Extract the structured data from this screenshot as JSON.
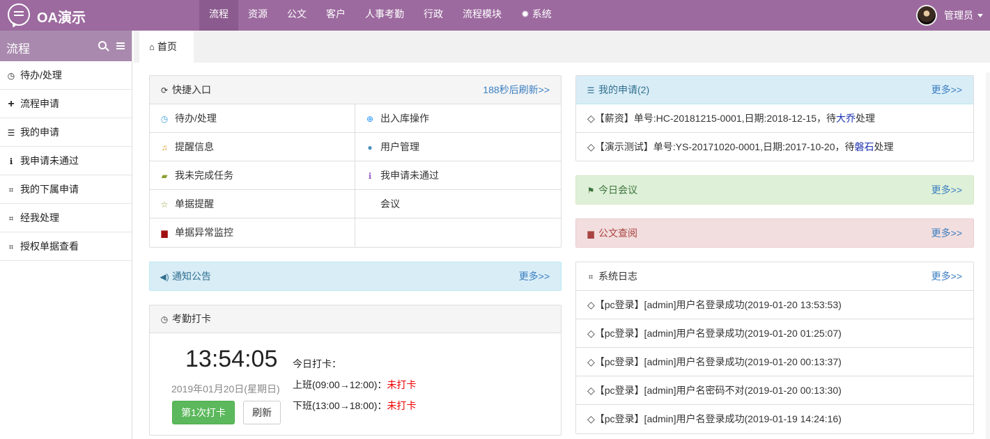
{
  "app": {
    "title": "OA演示"
  },
  "topnav": [
    {
      "label": "流程",
      "active": true
    },
    {
      "label": "资源"
    },
    {
      "label": "公文"
    },
    {
      "label": "客户"
    },
    {
      "label": "人事考勤"
    },
    {
      "label": "行政"
    },
    {
      "label": "流程模块"
    },
    {
      "label": "系统",
      "icon": "gear-icon"
    }
  ],
  "user": {
    "name": "管理员"
  },
  "sidebar": {
    "title": "流程",
    "items": [
      {
        "label": "待办/处理",
        "icon": "clock-icon"
      },
      {
        "label": "流程申请",
        "icon": "plus-icon"
      },
      {
        "label": "我的申请",
        "icon": "list-icon"
      },
      {
        "label": "我申请未通过",
        "icon": "info-icon"
      },
      {
        "label": "我的下属申请",
        "icon": "bookmark-icon"
      },
      {
        "label": "经我处理",
        "icon": "bookmark-icon"
      },
      {
        "label": "授权单据查看",
        "icon": "bookmark-icon"
      }
    ]
  },
  "tabs": [
    {
      "label": "首页",
      "icon": "home-icon"
    }
  ],
  "quick": {
    "title": "快捷入口",
    "refresh": "188秒后刷新>>",
    "items": [
      {
        "label": "待办/处理",
        "icon": "clock-icon",
        "color": "#3a9fd6"
      },
      {
        "label": "出入库操作",
        "icon": "plus-circle-icon",
        "color": "#1e90ff"
      },
      {
        "label": "提醒信息",
        "icon": "bell-icon",
        "color": "#e0a030"
      },
      {
        "label": "用户管理",
        "icon": "user-icon",
        "color": "#4a90c0"
      },
      {
        "label": "我未完成任务",
        "icon": "book-icon",
        "color": "#8aa030"
      },
      {
        "label": "我申请未通过",
        "icon": "info-icon",
        "color": "#9a60c0"
      },
      {
        "label": "单据提醒",
        "icon": "star-icon",
        "color": "#8aa030"
      },
      {
        "label": "会议",
        "icon": "",
        "color": ""
      },
      {
        "label": "单据异常监控",
        "icon": "briefcase-icon",
        "color": "#a01010"
      },
      {
        "label": "",
        "icon": "",
        "color": ""
      }
    ]
  },
  "notice": {
    "title": "通知公告",
    "more": "更多>>"
  },
  "attendance": {
    "title": "考勤打卡",
    "time": "13:54:05",
    "date": "2019年01月20日(星期日)",
    "punch_button": "第1次打卡",
    "refresh_button": "刷新",
    "today_label": "今日打卡：",
    "morning_label": "上班(09:00→12:00)：",
    "morning_status": "未打卡",
    "afternoon_label": "下班(13:00→18:00)：",
    "afternoon_status": "未打卡"
  },
  "my_apply": {
    "title": "我的申请(2)",
    "more": "更多>>",
    "rows": [
      {
        "prefix": "◇【薪资】单号:HC-20181215-0001,日期:2018-12-15，待",
        "name": "大乔",
        "suffix": "处理"
      },
      {
        "prefix": "◇【演示测试】单号:YS-20171020-0001,日期:2017-10-20，待",
        "name": "磐石",
        "suffix": "处理"
      }
    ]
  },
  "meeting": {
    "title": "今日会议",
    "more": "更多>>"
  },
  "docs": {
    "title": "公文查阅",
    "more": "更多>>"
  },
  "syslog": {
    "title": "系统日志",
    "more": "更多>>",
    "rows": [
      "◇【pc登录】[admin]用户名登录成功(2019-01-20 13:53:53)",
      "◇【pc登录】[admin]用户名登录成功(2019-01-20 01:25:07)",
      "◇【pc登录】[admin]用户名登录成功(2019-01-20 00:13:37)",
      "◇【pc登录】[admin]用户名密码不对(2019-01-20 00:13:30)",
      "◇【pc登录】[admin]用户名登录成功(2019-01-19 14:24:16)"
    ]
  }
}
